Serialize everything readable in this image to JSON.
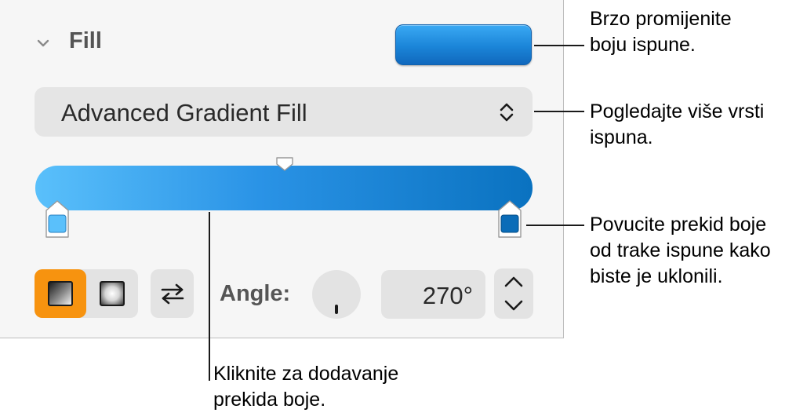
{
  "fill_panel": {
    "section_title": "Fill",
    "current_color": "#1b85d8",
    "fill_type": "Advanced Gradient Fill",
    "gradient": {
      "start_color": "#5ac0fb",
      "end_color": "#0a72c0"
    },
    "angle_label": "Angle:",
    "angle_value": "270°",
    "icons": {
      "collapse": "chevron-down-icon",
      "dropdown": "up-down-chevron-icon",
      "linear": "linear-gradient-icon",
      "radial": "radial-gradient-icon",
      "swap": "swap-arrows-icon",
      "stepper_up": "chevron-up-icon",
      "stepper_down": "chevron-down-icon"
    },
    "accent_color": "#f7930f"
  },
  "callouts": {
    "color_well": [
      "Brzo promijenite",
      "boju ispune."
    ],
    "fill_type": [
      "Pogledajte više vrsti",
      "ispuna."
    ],
    "color_stop": [
      "Povucite prekid boje",
      "od trake ispune kako",
      "biste je uklonili."
    ],
    "gradient_bar": [
      "Kliknite za dodavanje",
      "prekida boje."
    ]
  }
}
